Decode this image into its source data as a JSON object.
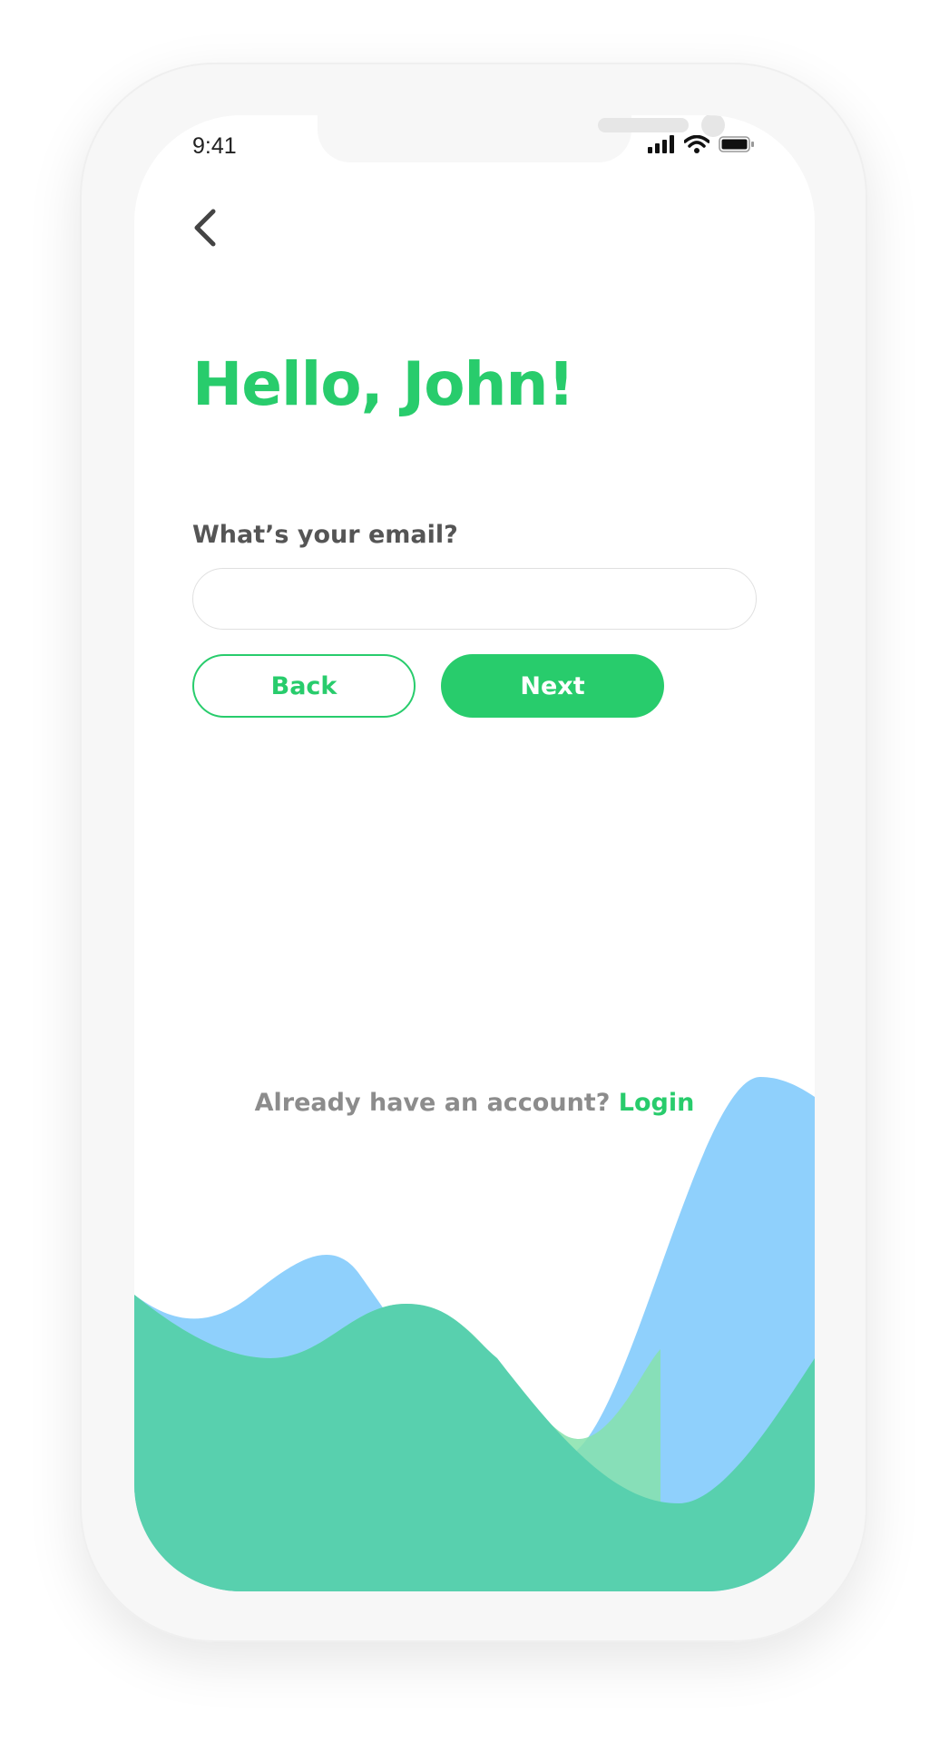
{
  "status_bar": {
    "time": "9:41",
    "icons": [
      "signal-icon",
      "wifi-icon",
      "battery-icon"
    ]
  },
  "nav": {
    "back_icon": "chevron-left-icon"
  },
  "greeting": {
    "title": "Hello, John!"
  },
  "form": {
    "email_label": "What’s your email?",
    "email_value": "",
    "email_placeholder": ""
  },
  "actions": {
    "back_label": "Back",
    "next_label": "Next"
  },
  "footer": {
    "prompt": "Already have an account?",
    "login_label": "Login"
  },
  "colors": {
    "accent": "#28cc6c",
    "wave_blue": "#8fd0fc",
    "wave_green_light": "#86e2ab",
    "wave_teal": "#58d0ae"
  }
}
